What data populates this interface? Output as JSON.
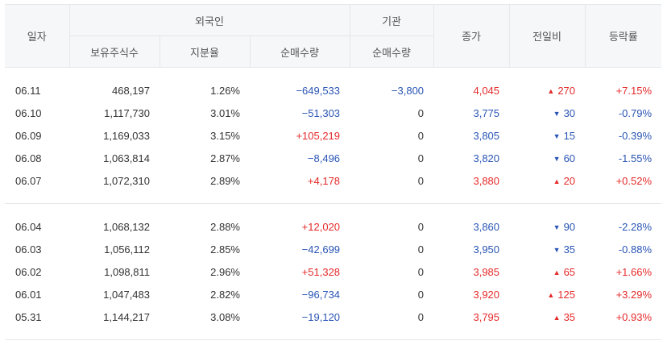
{
  "headers": {
    "date": "일자",
    "foreign": "외국인",
    "institution": "기관",
    "close": "종가",
    "change": "전일비",
    "rate": "등락률",
    "holding": "보유주식수",
    "share": "지분율",
    "foreign_net": "순매수량",
    "inst_net": "순매수량"
  },
  "colors": {
    "up": "#e52a2a",
    "down": "#2a55b5",
    "header_bg": "#f6f7f9"
  },
  "group1": [
    {
      "date": "06.11",
      "holding": "468,197",
      "share": "1.26%",
      "foreign_net": "−649,533",
      "inst_net": "−3,800",
      "close": "4,045",
      "arrow": "▲",
      "change": "270",
      "rate": "+7.15%",
      "dir": "up",
      "fdir": "down",
      "idir": "down"
    },
    {
      "date": "06.10",
      "holding": "1,117,730",
      "share": "3.01%",
      "foreign_net": "−51,303",
      "inst_net": "0",
      "close": "3,775",
      "arrow": "▼",
      "change": "30",
      "rate": "-0.79%",
      "dir": "down",
      "fdir": "down",
      "idir": "zero"
    },
    {
      "date": "06.09",
      "holding": "1,169,033",
      "share": "3.15%",
      "foreign_net": "+105,219",
      "inst_net": "0",
      "close": "3,805",
      "arrow": "▼",
      "change": "15",
      "rate": "-0.39%",
      "dir": "down",
      "fdir": "up",
      "idir": "zero"
    },
    {
      "date": "06.08",
      "holding": "1,063,814",
      "share": "2.87%",
      "foreign_net": "−8,496",
      "inst_net": "0",
      "close": "3,820",
      "arrow": "▼",
      "change": "60",
      "rate": "-1.55%",
      "dir": "down",
      "fdir": "down",
      "idir": "zero"
    },
    {
      "date": "06.07",
      "holding": "1,072,310",
      "share": "2.89%",
      "foreign_net": "+4,178",
      "inst_net": "0",
      "close": "3,880",
      "arrow": "▲",
      "change": "20",
      "rate": "+0.52%",
      "dir": "up",
      "fdir": "up",
      "idir": "zero"
    }
  ],
  "group2": [
    {
      "date": "06.04",
      "holding": "1,068,132",
      "share": "2.88%",
      "foreign_net": "+12,020",
      "inst_net": "0",
      "close": "3,860",
      "arrow": "▼",
      "change": "90",
      "rate": "-2.28%",
      "dir": "down",
      "fdir": "up",
      "idir": "zero"
    },
    {
      "date": "06.03",
      "holding": "1,056,112",
      "share": "2.85%",
      "foreign_net": "−42,699",
      "inst_net": "0",
      "close": "3,950",
      "arrow": "▼",
      "change": "35",
      "rate": "-0.88%",
      "dir": "down",
      "fdir": "down",
      "idir": "zero"
    },
    {
      "date": "06.02",
      "holding": "1,098,811",
      "share": "2.96%",
      "foreign_net": "+51,328",
      "inst_net": "0",
      "close": "3,985",
      "arrow": "▲",
      "change": "65",
      "rate": "+1.66%",
      "dir": "up",
      "fdir": "up",
      "idir": "zero"
    },
    {
      "date": "06.01",
      "holding": "1,047,483",
      "share": "2.82%",
      "foreign_net": "−96,734",
      "inst_net": "0",
      "close": "3,920",
      "arrow": "▲",
      "change": "125",
      "rate": "+3.29%",
      "dir": "up",
      "fdir": "down",
      "idir": "zero"
    },
    {
      "date": "05.31",
      "holding": "1,144,217",
      "share": "3.08%",
      "foreign_net": "−19,120",
      "inst_net": "0",
      "close": "3,795",
      "arrow": "▲",
      "change": "35",
      "rate": "+0.93%",
      "dir": "up",
      "fdir": "down",
      "idir": "zero"
    }
  ]
}
